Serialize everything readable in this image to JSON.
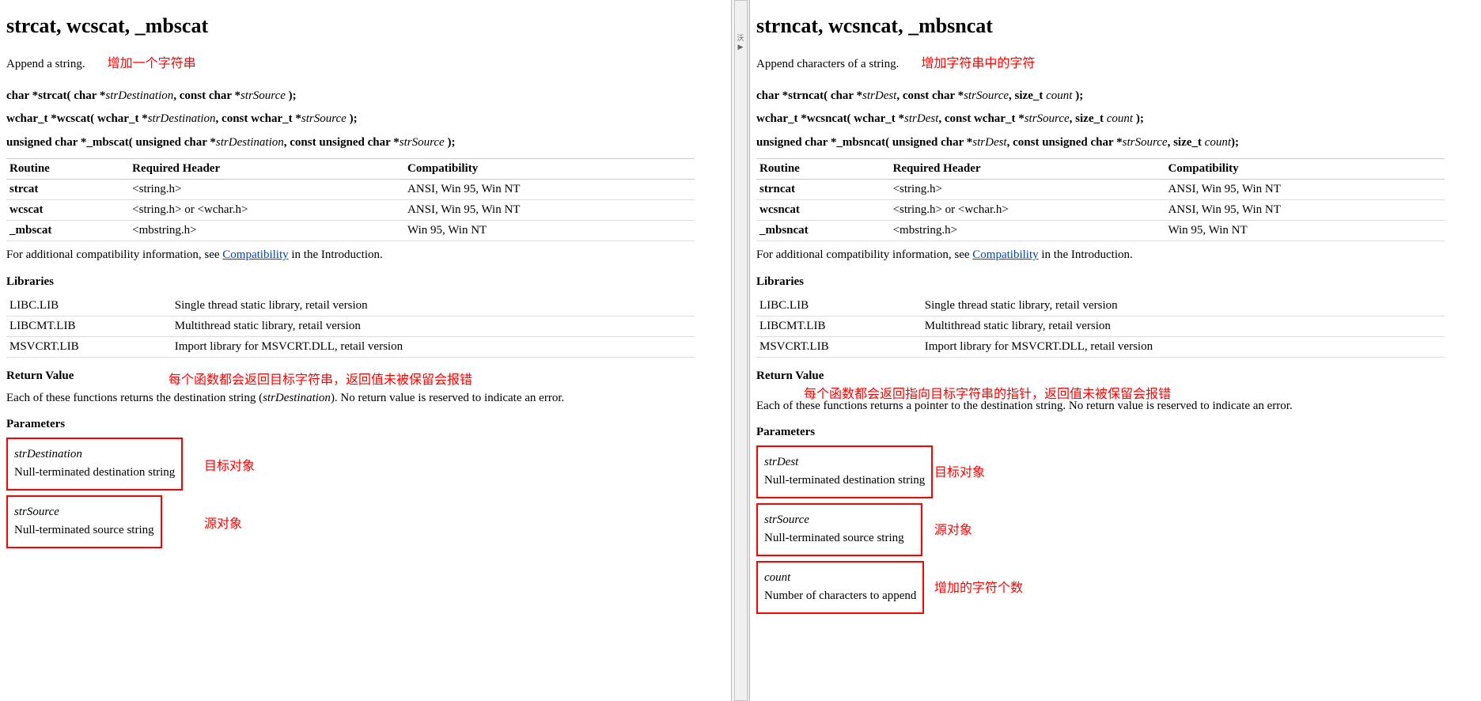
{
  "left": {
    "title": "strcat, wcscat, _mbscat",
    "desc": "Append a string.",
    "desc_anno": "增加一个字符串",
    "sig1_a": "char *strcat( char *",
    "sig1_b": "strDestination",
    "sig1_c": ", const char *",
    "sig1_d": "strSource",
    "sig1_e": " );",
    "sig2_a": "wchar_t *wcscat( wchar_t *",
    "sig2_b": "strDestination",
    "sig2_c": ", const wchar_t *",
    "sig2_d": "strSource",
    "sig2_e": " );",
    "sig3_a": "unsigned char *_mbscat( unsigned char *",
    "sig3_b": "strDestination",
    "sig3_c": ", const unsigned char *",
    "sig3_d": "strSource",
    "sig3_e": " );",
    "th1": "Routine",
    "th2": "Required Header",
    "th3": "Compatibility",
    "r1c1": "strcat",
    "r1c2": "<string.h>",
    "r1c3": "ANSI, Win 95, Win NT",
    "r2c1": "wcscat",
    "r2c2": "<string.h> or <wchar.h>",
    "r2c3": "ANSI, Win 95, Win NT",
    "r3c1": "_mbscat",
    "r3c2": "<mbstring.h>",
    "r3c3": "Win 95, Win NT",
    "compat_a": "For additional compatibility information, see ",
    "compat_link": "Compatibility",
    "compat_b": " in the Introduction.",
    "libs_hdr": "Libraries",
    "l1a": "LIBC.LIB",
    "l1b": "Single thread static library, retail version",
    "l2a": "LIBCMT.LIB",
    "l2b": "Multithread static library, retail version",
    "l3a": "MSVCRT.LIB",
    "l3b": "Import library for MSVCRT.DLL, retail version",
    "rv_hdr": "Return Value",
    "rv_anno": "每个函数都会返回目标字符串，返回值未被保留会报错",
    "rv_a": "Each of these functions returns the destination string (",
    "rv_b": "strDestination",
    "rv_c": "). No return value is reserved to indicate an error.",
    "params_hdr": "Parameters",
    "p1_name": "strDestination",
    "p1_desc": "Null-terminated destination string",
    "p1_anno": "目标对象",
    "p2_name": "strSource",
    "p2_desc": "Null-terminated source string",
    "p2_anno": "源对象"
  },
  "right": {
    "title": "strncat, wcsncat, _mbsncat",
    "desc": "Append characters of a string.",
    "desc_anno": "增加字符串中的字符",
    "sig1_a": "char *strncat( char *",
    "sig1_b": "strDest",
    "sig1_c": ", const char *",
    "sig1_d": "strSource",
    "sig1_e": ", size_t ",
    "sig1_f": "count",
    "sig1_g": " );",
    "sig2_a": "wchar_t *wcsncat( wchar_t *",
    "sig2_b": "strDest",
    "sig2_c": ", const wchar_t *",
    "sig2_d": "strSource",
    "sig2_e": ", size_t ",
    "sig2_f": "count",
    "sig2_g": " );",
    "sig3_a": "unsigned char *_mbsncat( unsigned char *",
    "sig3_b": "strDest",
    "sig3_c": ", const unsigned char *",
    "sig3_d": "strSource",
    "sig3_e": ", size_t ",
    "sig3_f": "count",
    "sig3_g": ");",
    "th1": "Routine",
    "th2": "Required Header",
    "th3": "Compatibility",
    "r1c1": "strncat",
    "r1c2": "<string.h>",
    "r1c3": "ANSI, Win 95, Win NT",
    "r2c1": "wcsncat",
    "r2c2": "<string.h> or <wchar.h>",
    "r2c3": "ANSI, Win 95, Win NT",
    "r3c1": "_mbsncat",
    "r3c2": "<mbstring.h>",
    "r3c3": "Win 95, Win NT",
    "compat_a": "For additional compatibility information, see ",
    "compat_link": "Compatibility",
    "compat_b": " in the Introduction.",
    "libs_hdr": "Libraries",
    "l1a": "LIBC.LIB",
    "l1b": "Single thread static library, retail version",
    "l2a": "LIBCMT.LIB",
    "l2b": "Multithread static library, retail version",
    "l3a": "MSVCRT.LIB",
    "l3b": "Import library for MSVCRT.DLL, retail version",
    "rv_hdr": "Return Value",
    "rv_anno": "每个函数都会返回指向目标字符串的指针，返回值未被保留会报错",
    "rv_text": "Each of these functions returns a pointer to the destination string. No return value is reserved to indicate an error.",
    "params_hdr": "Parameters",
    "p1_name": "strDest",
    "p1_desc": "Null-terminated destination string",
    "p1_anno": "目标对象",
    "p2_name": "strSource",
    "p2_desc": "Null-terminated source string",
    "p2_anno": "源对象",
    "p3_name": "count",
    "p3_desc": "Number of characters to append",
    "p3_anno": "增加的字符个数"
  }
}
